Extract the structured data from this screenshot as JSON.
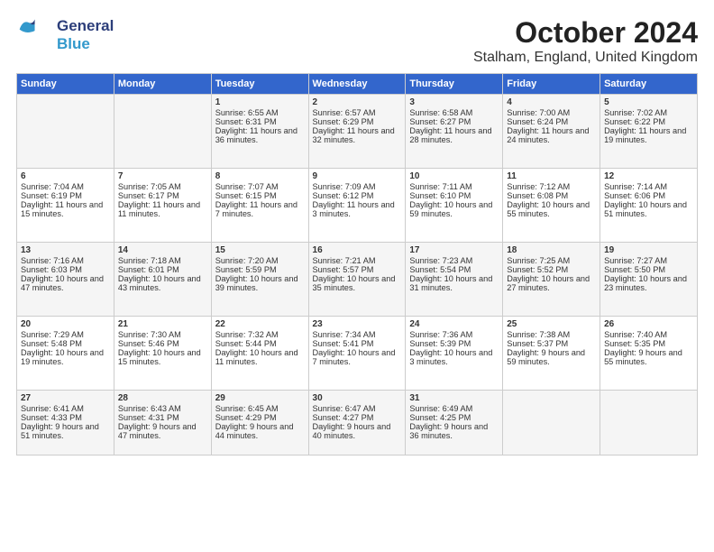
{
  "header": {
    "logo_line1": "General",
    "logo_line2": "Blue",
    "month_title": "October 2024",
    "location": "Stalham, England, United Kingdom"
  },
  "days_of_week": [
    "Sunday",
    "Monday",
    "Tuesday",
    "Wednesday",
    "Thursday",
    "Friday",
    "Saturday"
  ],
  "weeks": [
    [
      {
        "day": "",
        "content": ""
      },
      {
        "day": "",
        "content": ""
      },
      {
        "day": "1",
        "content": "Sunrise: 6:55 AM\nSunset: 6:31 PM\nDaylight: 11 hours and 36 minutes."
      },
      {
        "day": "2",
        "content": "Sunrise: 6:57 AM\nSunset: 6:29 PM\nDaylight: 11 hours and 32 minutes."
      },
      {
        "day": "3",
        "content": "Sunrise: 6:58 AM\nSunset: 6:27 PM\nDaylight: 11 hours and 28 minutes."
      },
      {
        "day": "4",
        "content": "Sunrise: 7:00 AM\nSunset: 6:24 PM\nDaylight: 11 hours and 24 minutes."
      },
      {
        "day": "5",
        "content": "Sunrise: 7:02 AM\nSunset: 6:22 PM\nDaylight: 11 hours and 19 minutes."
      }
    ],
    [
      {
        "day": "6",
        "content": "Sunrise: 7:04 AM\nSunset: 6:19 PM\nDaylight: 11 hours and 15 minutes."
      },
      {
        "day": "7",
        "content": "Sunrise: 7:05 AM\nSunset: 6:17 PM\nDaylight: 11 hours and 11 minutes."
      },
      {
        "day": "8",
        "content": "Sunrise: 7:07 AM\nSunset: 6:15 PM\nDaylight: 11 hours and 7 minutes."
      },
      {
        "day": "9",
        "content": "Sunrise: 7:09 AM\nSunset: 6:12 PM\nDaylight: 11 hours and 3 minutes."
      },
      {
        "day": "10",
        "content": "Sunrise: 7:11 AM\nSunset: 6:10 PM\nDaylight: 10 hours and 59 minutes."
      },
      {
        "day": "11",
        "content": "Sunrise: 7:12 AM\nSunset: 6:08 PM\nDaylight: 10 hours and 55 minutes."
      },
      {
        "day": "12",
        "content": "Sunrise: 7:14 AM\nSunset: 6:06 PM\nDaylight: 10 hours and 51 minutes."
      }
    ],
    [
      {
        "day": "13",
        "content": "Sunrise: 7:16 AM\nSunset: 6:03 PM\nDaylight: 10 hours and 47 minutes."
      },
      {
        "day": "14",
        "content": "Sunrise: 7:18 AM\nSunset: 6:01 PM\nDaylight: 10 hours and 43 minutes."
      },
      {
        "day": "15",
        "content": "Sunrise: 7:20 AM\nSunset: 5:59 PM\nDaylight: 10 hours and 39 minutes."
      },
      {
        "day": "16",
        "content": "Sunrise: 7:21 AM\nSunset: 5:57 PM\nDaylight: 10 hours and 35 minutes."
      },
      {
        "day": "17",
        "content": "Sunrise: 7:23 AM\nSunset: 5:54 PM\nDaylight: 10 hours and 31 minutes."
      },
      {
        "day": "18",
        "content": "Sunrise: 7:25 AM\nSunset: 5:52 PM\nDaylight: 10 hours and 27 minutes."
      },
      {
        "day": "19",
        "content": "Sunrise: 7:27 AM\nSunset: 5:50 PM\nDaylight: 10 hours and 23 minutes."
      }
    ],
    [
      {
        "day": "20",
        "content": "Sunrise: 7:29 AM\nSunset: 5:48 PM\nDaylight: 10 hours and 19 minutes."
      },
      {
        "day": "21",
        "content": "Sunrise: 7:30 AM\nSunset: 5:46 PM\nDaylight: 10 hours and 15 minutes."
      },
      {
        "day": "22",
        "content": "Sunrise: 7:32 AM\nSunset: 5:44 PM\nDaylight: 10 hours and 11 minutes."
      },
      {
        "day": "23",
        "content": "Sunrise: 7:34 AM\nSunset: 5:41 PM\nDaylight: 10 hours and 7 minutes."
      },
      {
        "day": "24",
        "content": "Sunrise: 7:36 AM\nSunset: 5:39 PM\nDaylight: 10 hours and 3 minutes."
      },
      {
        "day": "25",
        "content": "Sunrise: 7:38 AM\nSunset: 5:37 PM\nDaylight: 9 hours and 59 minutes."
      },
      {
        "day": "26",
        "content": "Sunrise: 7:40 AM\nSunset: 5:35 PM\nDaylight: 9 hours and 55 minutes."
      }
    ],
    [
      {
        "day": "27",
        "content": "Sunrise: 6:41 AM\nSunset: 4:33 PM\nDaylight: 9 hours and 51 minutes."
      },
      {
        "day": "28",
        "content": "Sunrise: 6:43 AM\nSunset: 4:31 PM\nDaylight: 9 hours and 47 minutes."
      },
      {
        "day": "29",
        "content": "Sunrise: 6:45 AM\nSunset: 4:29 PM\nDaylight: 9 hours and 44 minutes."
      },
      {
        "day": "30",
        "content": "Sunrise: 6:47 AM\nSunset: 4:27 PM\nDaylight: 9 hours and 40 minutes."
      },
      {
        "day": "31",
        "content": "Sunrise: 6:49 AM\nSunset: 4:25 PM\nDaylight: 9 hours and 36 minutes."
      },
      {
        "day": "",
        "content": ""
      },
      {
        "day": "",
        "content": ""
      }
    ]
  ]
}
